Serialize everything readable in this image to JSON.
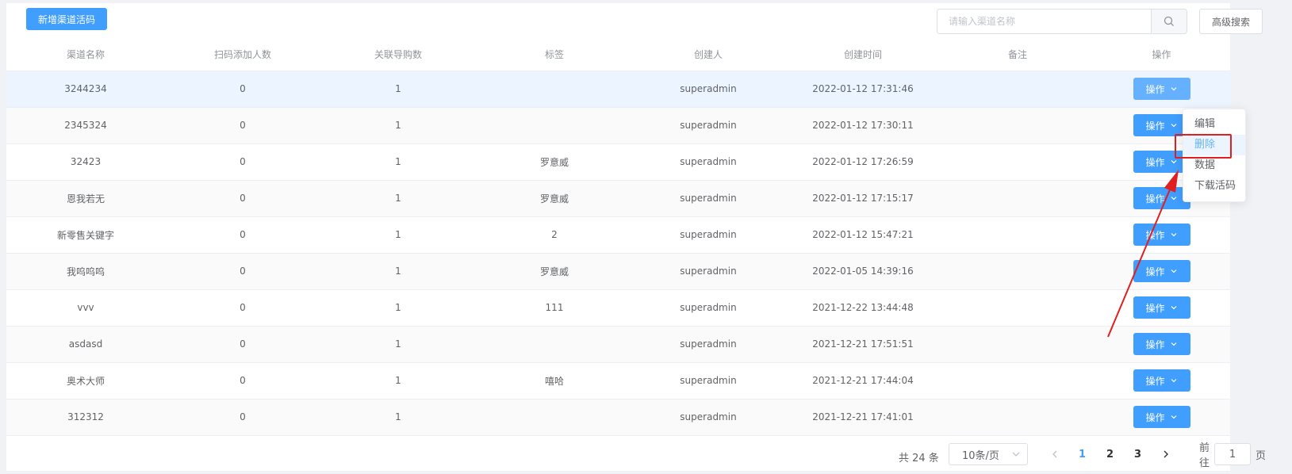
{
  "toolbar": {
    "add_label": "新增渠道活码",
    "search_placeholder": "请输入渠道名称",
    "search_value": "",
    "advanced_label": "高级搜索"
  },
  "table": {
    "headers": [
      "渠道名称",
      "扫码添加人数",
      "关联导购数",
      "标签",
      "创建人",
      "创建时间",
      "备注",
      "操作"
    ],
    "rows": [
      {
        "name": "3244234",
        "scan": "0",
        "guide": "1",
        "tag": "",
        "creator": "superadmin",
        "time": "2022-01-12 17:31:46",
        "note": "",
        "op": "操作"
      },
      {
        "name": "2345324",
        "scan": "0",
        "guide": "1",
        "tag": "",
        "creator": "superadmin",
        "time": "2022-01-12 17:30:11",
        "note": "",
        "op": "操作"
      },
      {
        "name": "32423",
        "scan": "0",
        "guide": "1",
        "tag": "罗意威",
        "creator": "superadmin",
        "time": "2022-01-12 17:26:59",
        "note": "",
        "op": "操作"
      },
      {
        "name": "恩我若无",
        "scan": "0",
        "guide": "1",
        "tag": "罗意威",
        "creator": "superadmin",
        "time": "2022-01-12 17:15:17",
        "note": "",
        "op": "操作"
      },
      {
        "name": "新零售关键字",
        "scan": "0",
        "guide": "1",
        "tag": "2",
        "creator": "superadmin",
        "time": "2022-01-12 15:47:21",
        "note": "",
        "op": "操作"
      },
      {
        "name": "我呜呜呜",
        "scan": "0",
        "guide": "1",
        "tag": "罗意威",
        "creator": "superadmin",
        "time": "2022-01-05 14:39:16",
        "note": "",
        "op": "操作"
      },
      {
        "name": "vvv",
        "scan": "0",
        "guide": "1",
        "tag": "111",
        "creator": "superadmin",
        "time": "2021-12-22 13:44:48",
        "note": "",
        "op": "操作"
      },
      {
        "name": "asdasd",
        "scan": "0",
        "guide": "1",
        "tag": "",
        "creator": "superadmin",
        "time": "2021-12-21 17:51:51",
        "note": "",
        "op": "操作"
      },
      {
        "name": "奥术大师",
        "scan": "0",
        "guide": "1",
        "tag": "嘻哈",
        "creator": "superadmin",
        "time": "2021-12-21 17:44:04",
        "note": "",
        "op": "操作"
      },
      {
        "name": "312312",
        "scan": "0",
        "guide": "1",
        "tag": "",
        "creator": "superadmin",
        "time": "2021-12-21 17:41:01",
        "note": "",
        "op": "操作"
      }
    ]
  },
  "dropdown": {
    "items": [
      "编辑",
      "删除",
      "数据",
      "下载活码"
    ],
    "highlighted": "删除"
  },
  "pagination": {
    "total": "共 24 条",
    "page_size": "10条/页",
    "pages": [
      "1",
      "2",
      "3"
    ],
    "current": "1",
    "goto_prefix": "前往",
    "goto_value": "1",
    "goto_suffix": "页"
  },
  "colors": {
    "primary": "#409eff",
    "primary_light": "#66b1ff",
    "annotation": "#e02020"
  },
  "icons": [
    "search-icon",
    "chevron-down-icon",
    "chevron-left-icon",
    "chevron-right-icon",
    "annotation-arrow"
  ]
}
